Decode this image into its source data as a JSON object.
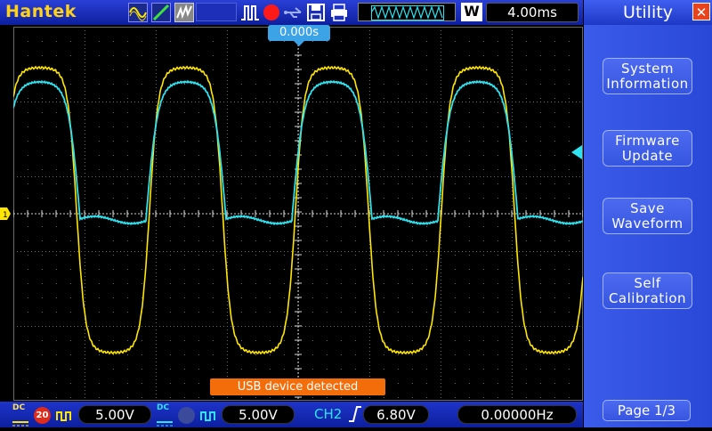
{
  "brand": "Hantek",
  "timebase": "4.00ms",
  "acquire_mode_label": "W",
  "trigger_position": "0.000s",
  "usb_message": "USB device detected",
  "channel1": {
    "coupling": "DC",
    "bw_limit": "20",
    "scale": "5.00V",
    "color": "#ffe600"
  },
  "channel2": {
    "coupling": "DC",
    "scale": "5.00V",
    "color": "#2ee3ef"
  },
  "trigger": {
    "source": "CH2",
    "level": "6.80V",
    "frequency": "0.00000Hz"
  },
  "menu": {
    "title": "Utility",
    "items": [
      {
        "label_line1": "System",
        "label_line2": "Information"
      },
      {
        "label_line1": "Firmware",
        "label_line2": "Update"
      },
      {
        "label_line1": "Save",
        "label_line2": "Waveform"
      },
      {
        "label_line1": "Self",
        "label_line2": "Calibration"
      }
    ],
    "page": "Page 1/3"
  },
  "icons": [
    "sine-wave-icon",
    "ramp-icon",
    "noise-icon",
    "pulse-icon",
    "record-icon",
    "usb-icon",
    "floppy-save-icon",
    "print-icon",
    "close-icon",
    "trigger-edge-icon",
    "ground-marker-icon"
  ]
}
